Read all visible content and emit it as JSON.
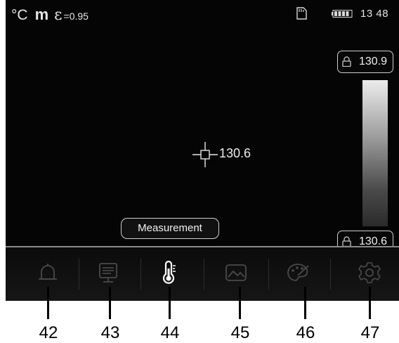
{
  "status": {
    "unit": "°C",
    "mode_letter": "m",
    "emissivity_symbol": "ε",
    "emissivity": "=0.95",
    "time": "13 48"
  },
  "scale": {
    "max": "130.9",
    "min": "130.6"
  },
  "crosshair": {
    "temperature": "130.6"
  },
  "mode_label": "Measurement",
  "menu": {
    "items": [
      {
        "icon": "bell-icon"
      },
      {
        "icon": "display-icon"
      },
      {
        "icon": "thermometer-icon"
      },
      {
        "icon": "image-icon"
      },
      {
        "icon": "palette-icon"
      },
      {
        "icon": "gear-icon"
      }
    ]
  },
  "callouts": [
    "42",
    "43",
    "44",
    "45",
    "46",
    "47"
  ],
  "colors": {
    "background": "#050505",
    "foreground": "#e6e6e6",
    "accent_white": "#ffffff"
  }
}
